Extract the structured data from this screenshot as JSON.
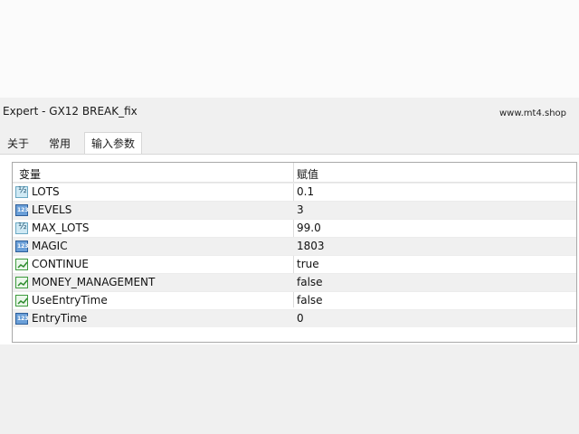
{
  "window": {
    "title": "Expert - GX12 BREAK_fix",
    "watermark": "www.mt4.shop"
  },
  "tabs": [
    {
      "label": "关于"
    },
    {
      "label": "常用"
    },
    {
      "label": "输入参数",
      "active": true
    }
  ],
  "table": {
    "columns": [
      "变量",
      "赋值"
    ],
    "rows": [
      {
        "icon": "double-value-icon",
        "name": "LOTS",
        "value": "0.1"
      },
      {
        "icon": "integer-value-icon",
        "name": "LEVELS",
        "value": "3"
      },
      {
        "icon": "double-value-icon",
        "name": "MAX_LOTS",
        "value": "99.0"
      },
      {
        "icon": "integer-value-icon",
        "name": "MAGIC",
        "value": "1803"
      },
      {
        "icon": "boolean-value-icon",
        "name": "CONTINUE",
        "value": "true"
      },
      {
        "icon": "boolean-value-icon",
        "name": "MONEY_MANAGEMENT",
        "value": "false"
      },
      {
        "icon": "boolean-value-icon",
        "name": "UseEntryTime",
        "value": "false"
      },
      {
        "icon": "integer-value-icon",
        "name": "EntryTime",
        "value": "0"
      }
    ]
  }
}
